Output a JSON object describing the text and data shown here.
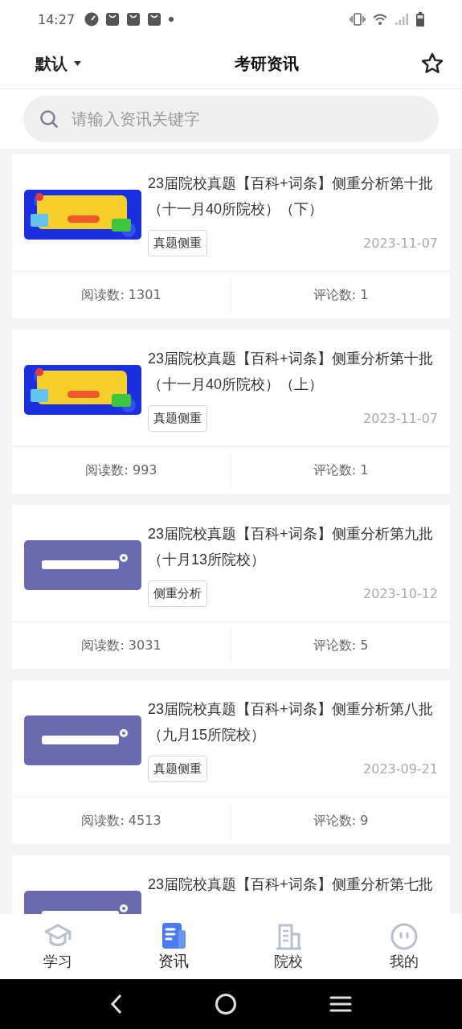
{
  "status_bar": {
    "time": "14:27"
  },
  "header": {
    "sort": "默认",
    "title": "考研资讯"
  },
  "search": {
    "placeholder": "请输入资讯关键字"
  },
  "articles": [
    {
      "title": "23届院校真题【百科+词条】侧重分析第十批（十一月40所院校）（下）",
      "tag": "真题侧重",
      "date": "2023-11-07",
      "reads": "阅读数: 1301",
      "comments": "评论数: 1"
    },
    {
      "title": "23届院校真题【百科+词条】侧重分析第十批（十一月40所院校）（上）",
      "tag": "真题侧重",
      "date": "2023-11-07",
      "reads": "阅读数: 993",
      "comments": "评论数: 1"
    },
    {
      "title": "23届院校真题【百科+词条】侧重分析第九批（十月13所院校）",
      "tag": "侧重分析",
      "date": "2023-10-12",
      "reads": "阅读数: 3031",
      "comments": "评论数: 5"
    },
    {
      "title": "23届院校真题【百科+词条】侧重分析第八批（九月15所院校）",
      "tag": "真题侧重",
      "date": "2023-09-21",
      "reads": "阅读数: 4513",
      "comments": "评论数: 9"
    },
    {
      "title": "23届院校真题【百科+词条】侧重分析第七批"
    }
  ],
  "tab_bar": [
    {
      "kind": "study",
      "label": "学习",
      "selected": false
    },
    {
      "kind": "news",
      "label": "资讯",
      "selected": true
    },
    {
      "kind": "school",
      "label": "院校",
      "selected": false
    },
    {
      "kind": "me",
      "label": "我的",
      "selected": false
    }
  ]
}
